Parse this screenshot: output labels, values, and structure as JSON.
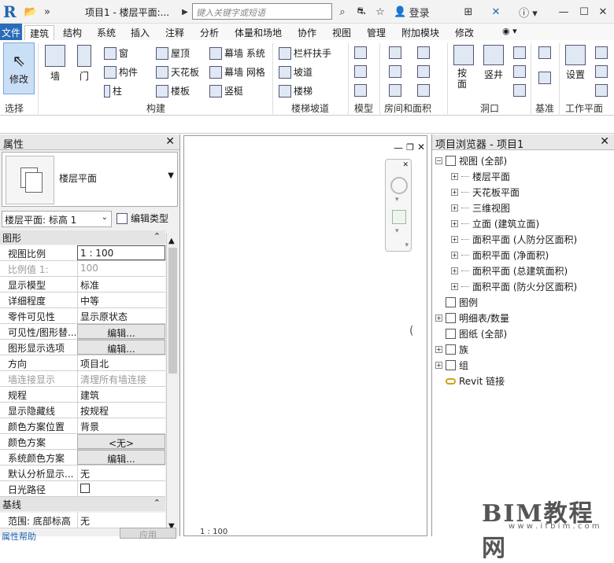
{
  "titlebar": {
    "app_icon": "R",
    "title": "项目1 - 楼层平面:...",
    "search_placeholder": "键入关键字或短语",
    "login": "登录"
  },
  "tabs": [
    "文件",
    "建筑",
    "结构",
    "系统",
    "插入",
    "注释",
    "分析",
    "体量和场地",
    "协作",
    "视图",
    "管理",
    "附加模块",
    "修改"
  ],
  "ribbon": {
    "modify": "修改",
    "select": "选择",
    "wall": "墙",
    "door": "门",
    "window": "窗",
    "component": "构件",
    "column": "柱",
    "roof": "屋顶",
    "ceiling": "天花板",
    "floor": "楼板",
    "curtain_system": "幕墙 系统",
    "curtain_grid": "幕墙 网格",
    "mullion": "竖梃",
    "build": "构建",
    "railing": "栏杆扶手",
    "ramp": "坡道",
    "stair": "楼梯",
    "circulation": "楼梯坡道",
    "model": "模型",
    "room_area": "房间和面积",
    "by_face": "按面",
    "shaft": "竖井",
    "opening": "洞口",
    "datum": "基准",
    "set": "设置",
    "workplane": "工作平面"
  },
  "properties": {
    "title": "属性",
    "type_name": "楼层平面",
    "instance": "楼层平面: 标高 1",
    "edit_type": "编辑类型",
    "group_graphics": "图形",
    "group_extents": "基线",
    "rows": [
      {
        "label": "视图比例",
        "value": "1 : 100"
      },
      {
        "label": "比例值 1:",
        "value": "100"
      },
      {
        "label": "显示模型",
        "value": "标准"
      },
      {
        "label": "详细程度",
        "value": "中等"
      },
      {
        "label": "零件可见性",
        "value": "显示原状态"
      },
      {
        "label": "可见性/图形替...",
        "value": "编辑..."
      },
      {
        "label": "图形显示选项",
        "value": "编辑..."
      },
      {
        "label": "方向",
        "value": "项目北"
      },
      {
        "label": "墙连接显示",
        "value": "清理所有墙连接"
      },
      {
        "label": "规程",
        "value": "建筑"
      },
      {
        "label": "显示隐藏线",
        "value": "按规程"
      },
      {
        "label": "颜色方案位置",
        "value": "背景"
      },
      {
        "label": "颜色方案",
        "value": "<无>"
      },
      {
        "label": "系统颜色方案",
        "value": "编辑..."
      },
      {
        "label": "默认分析显示...",
        "value": "无"
      },
      {
        "label": "日光路径",
        "value": ""
      }
    ],
    "extent_row": {
      "label": "范围: 底部标高",
      "value": "无"
    },
    "help": "属性帮助",
    "apply": "应用"
  },
  "browser": {
    "title": "项目浏览器 - 项目1",
    "nodes": [
      {
        "label": "视图 (全部)",
        "level": 0
      },
      {
        "label": "楼层平面",
        "level": 1
      },
      {
        "label": "天花板平面",
        "level": 1
      },
      {
        "label": "三维视图",
        "level": 1
      },
      {
        "label": "立面 (建筑立面)",
        "level": 1
      },
      {
        "label": "面积平面 (人防分区面积)",
        "level": 1
      },
      {
        "label": "面积平面 (净面积)",
        "level": 1
      },
      {
        "label": "面积平面 (总建筑面积)",
        "level": 1
      },
      {
        "label": "面积平面 (防火分区面积)",
        "level": 1
      },
      {
        "label": "图例",
        "level": 0
      },
      {
        "label": "明细表/数量",
        "level": 0
      },
      {
        "label": "图纸 (全部)",
        "level": 0
      },
      {
        "label": "族",
        "level": 0
      },
      {
        "label": "组",
        "level": 0
      },
      {
        "label": "Revit 链接",
        "level": 0
      }
    ]
  },
  "viewbar": {
    "scale": "1 : 100"
  },
  "watermark": {
    "main": "BIM教程网",
    "sub": "w w w . i f b i m . c o m"
  }
}
